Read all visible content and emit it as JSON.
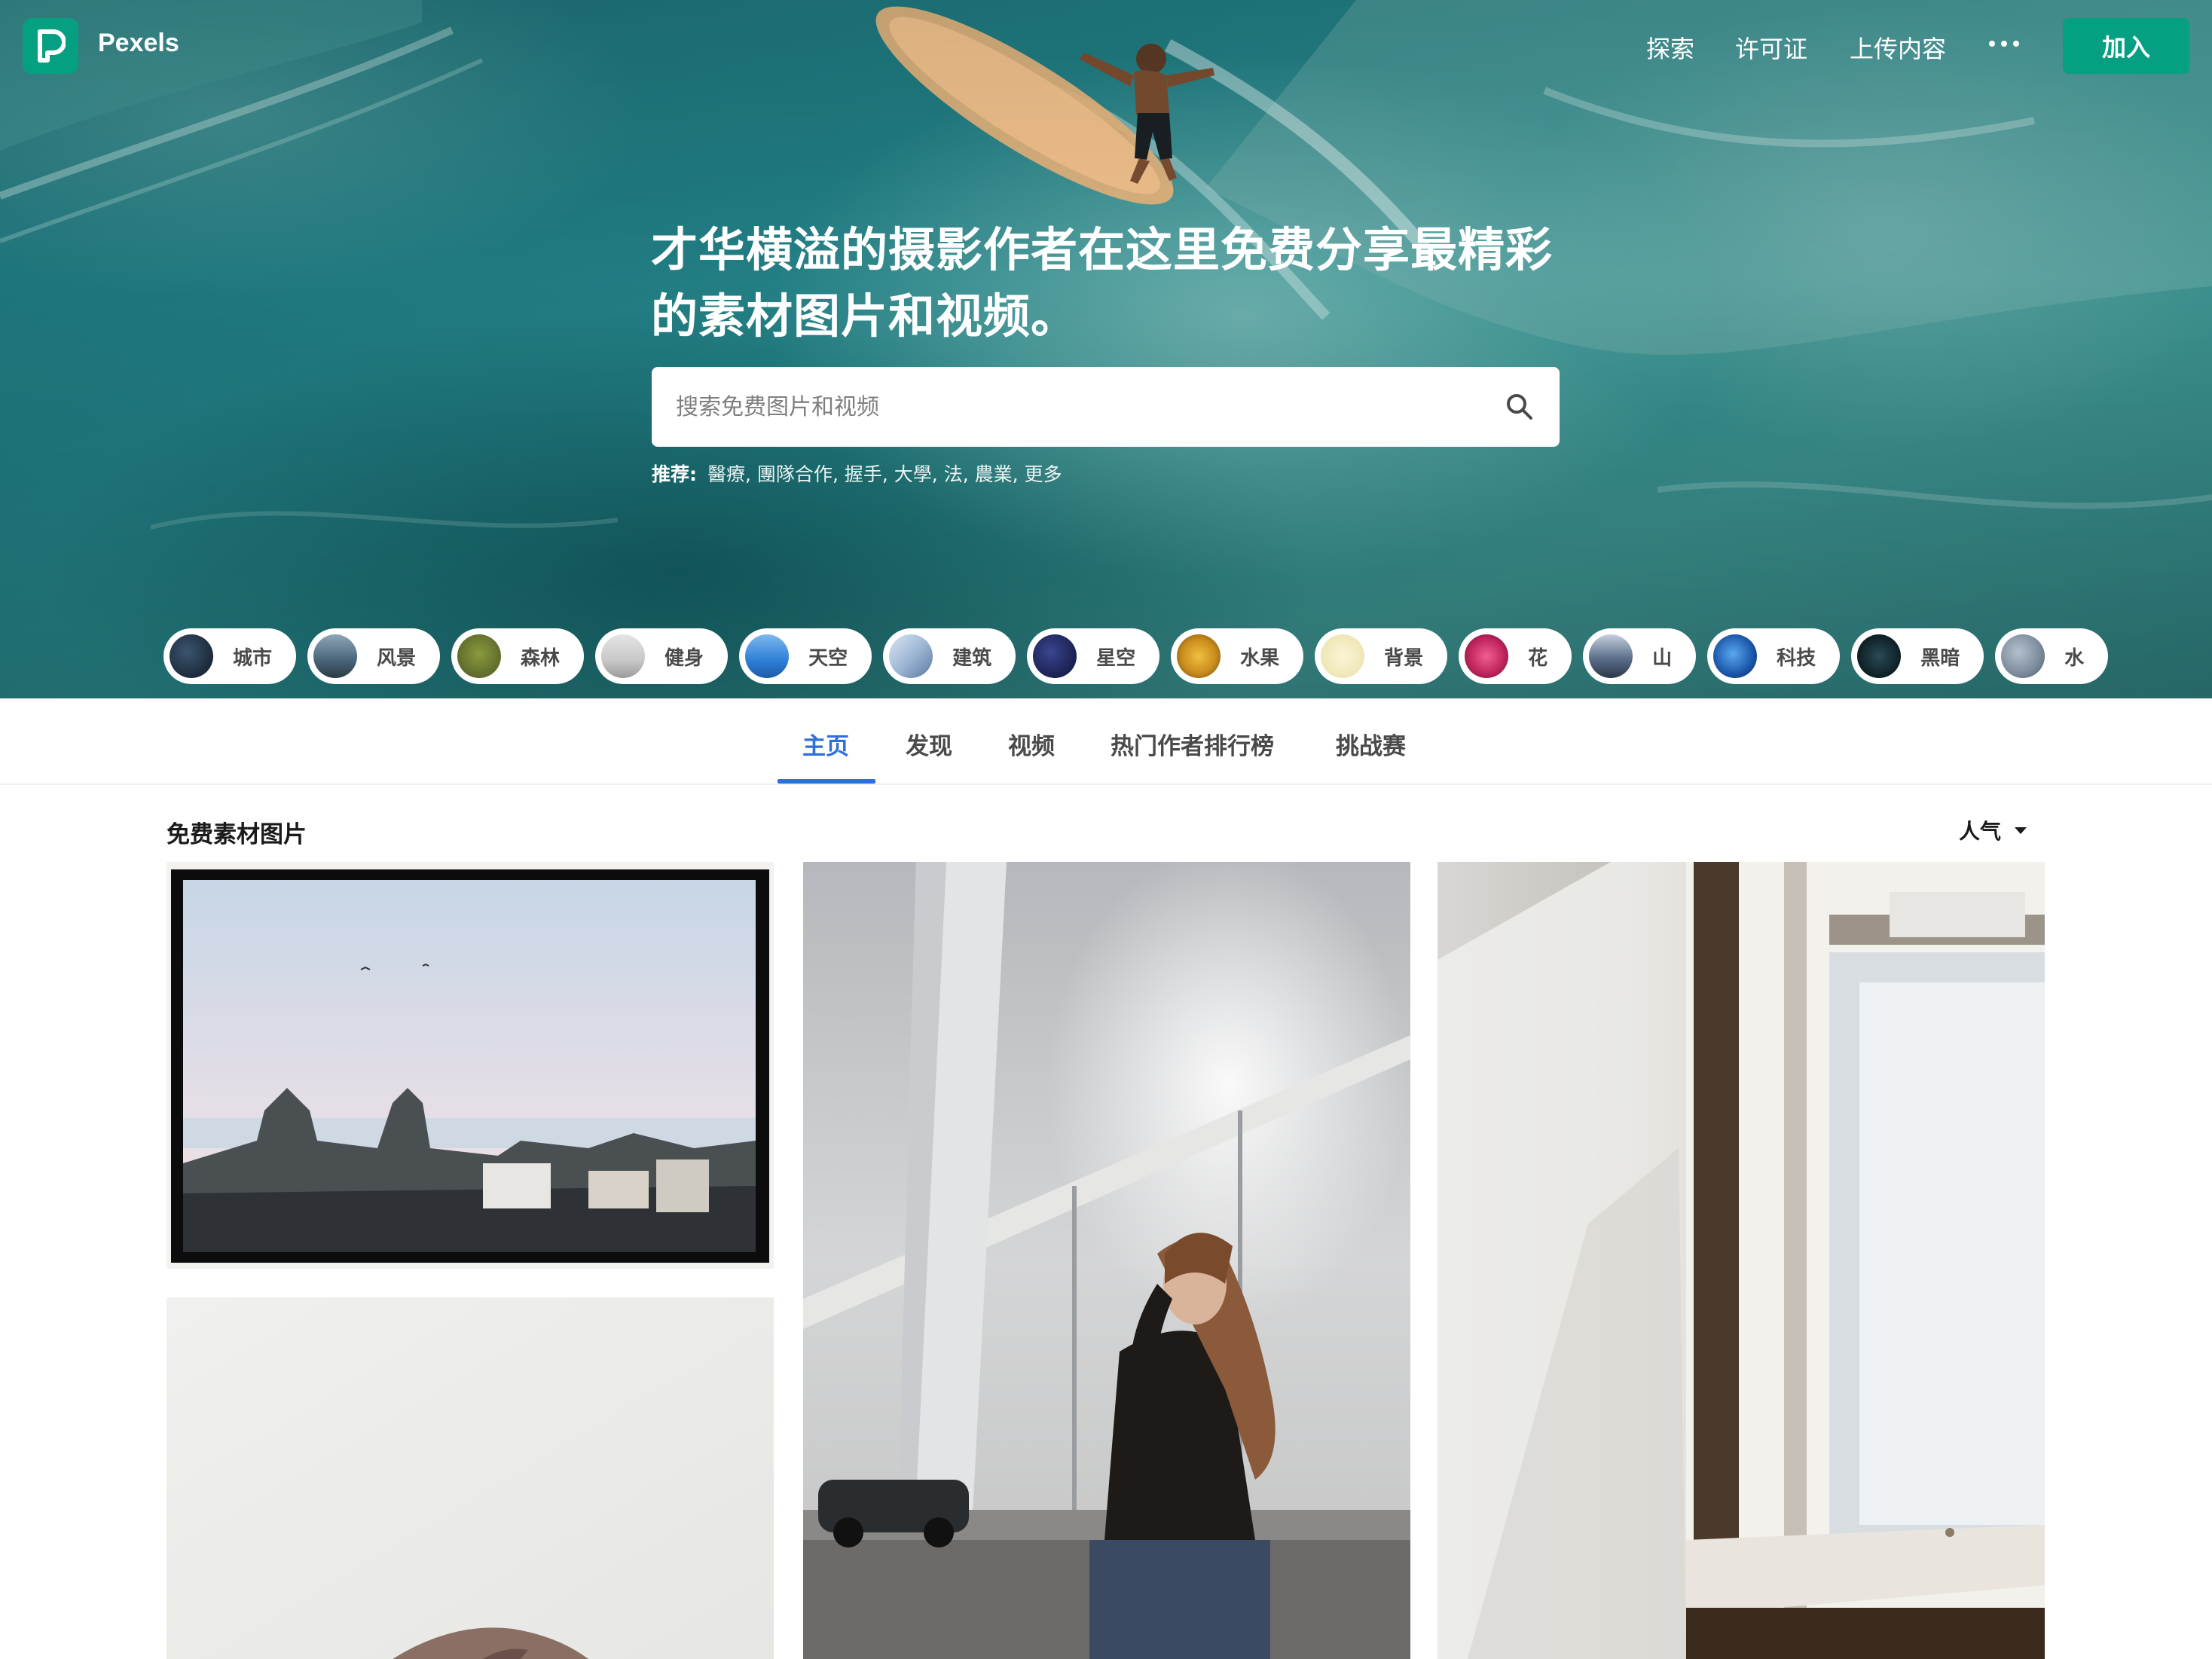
{
  "nav": {
    "logo_text": "Pexels",
    "links": [
      "探索",
      "许可证",
      "上传内容"
    ],
    "join_label": "加入"
  },
  "hero": {
    "headline": "才华横溢的摄影作者在这里免费分享最精彩的素材图片和视频。",
    "search_placeholder": "搜索免费图片和视频",
    "suggest_label": "推荐:",
    "suggestions": [
      "醫療",
      "團隊合作",
      "握手",
      "大學",
      "法",
      "農業",
      "更多"
    ]
  },
  "categories": [
    {
      "label": "城市",
      "color": "#1c2a3a"
    },
    {
      "label": "风景",
      "color": "#4d6a80"
    },
    {
      "label": "森林",
      "color": "#5f6b2c"
    },
    {
      "label": "健身",
      "color": "#c8c8c8"
    },
    {
      "label": "天空",
      "color": "#2d7fd6"
    },
    {
      "label": "建筑",
      "color": "#9fb8d6"
    },
    {
      "label": "星空",
      "color": "#1a2050"
    },
    {
      "label": "水果",
      "color": "#c98d1c"
    },
    {
      "label": "背景",
      "color": "#efe6b6"
    },
    {
      "label": "花",
      "color": "#c2255f"
    },
    {
      "label": "山",
      "color": "#5c6f8a"
    },
    {
      "label": "科技",
      "color": "#1a55a8"
    },
    {
      "label": "黑暗",
      "color": "#0d1e24"
    },
    {
      "label": "水",
      "color": "#7b8b9c"
    }
  ],
  "tabs": [
    "主页",
    "发现",
    "视频",
    "热门作者排行榜",
    "挑战赛"
  ],
  "active_tab": "主页",
  "section": {
    "title": "免费素材图片",
    "sort_label": "人气"
  },
  "icons": {
    "logo": "pexels-logo-icon",
    "more": "more-dots-icon",
    "search": "search-icon",
    "sort": "caret-down-icon"
  },
  "colors": {
    "brand": "#05a081",
    "tab_active": "#2f6fd8"
  }
}
